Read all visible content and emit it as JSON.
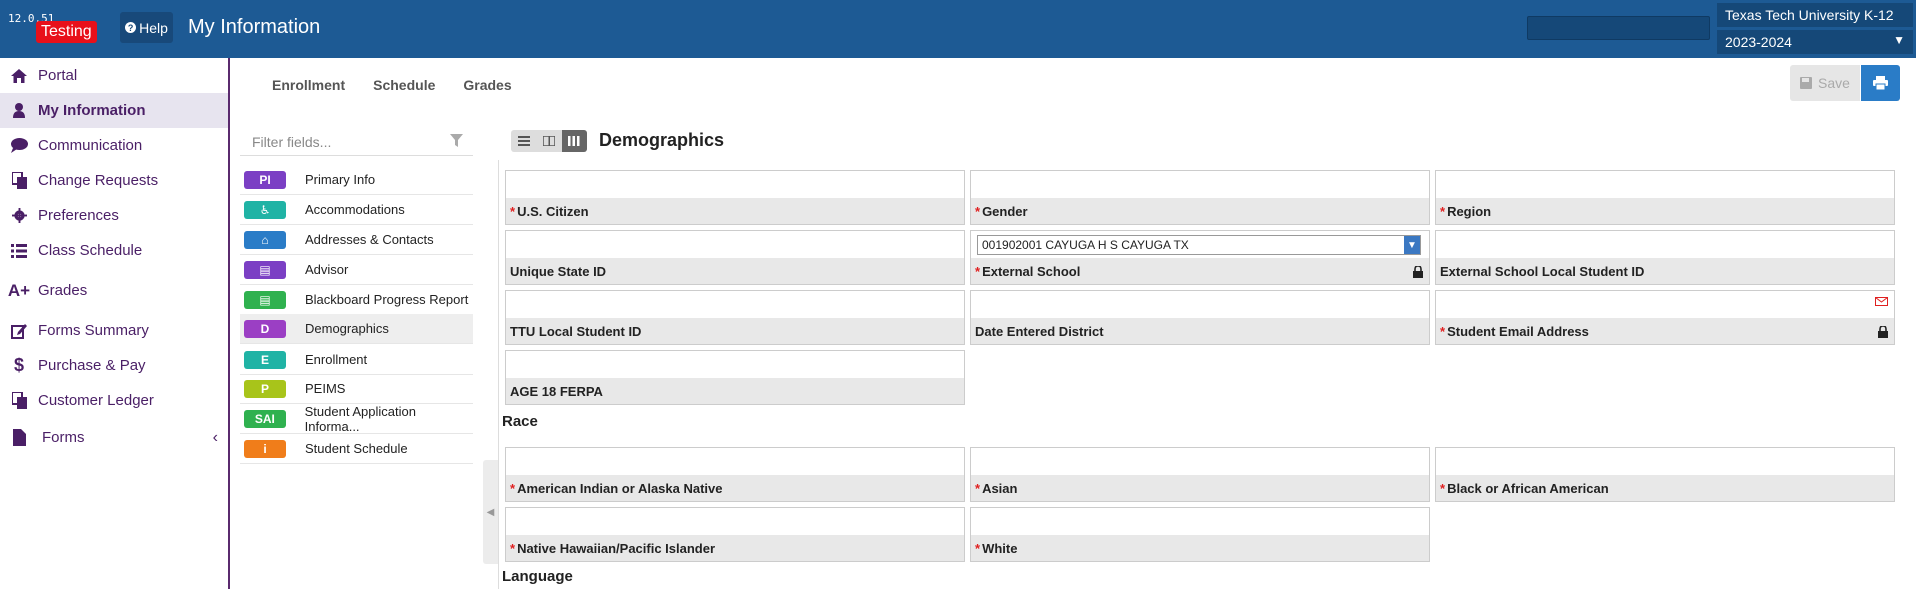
{
  "header": {
    "version": "12.0.51",
    "testing_label": "Testing",
    "help_label": "Help",
    "page_title": "My Information",
    "org": "Texas Tech University K-12",
    "year": "2023-2024",
    "colors": {
      "bar": "#1d5a94",
      "accent": "#4a1f66",
      "testing": "#e8101a"
    }
  },
  "sidebar": {
    "items": [
      {
        "label": "Portal",
        "icon": "home-icon"
      },
      {
        "label": "My Information",
        "icon": "user-icon",
        "active": true
      },
      {
        "label": "Communication",
        "icon": "chat-icon"
      },
      {
        "label": "Change Requests",
        "icon": "copy-icon"
      },
      {
        "label": "Preferences",
        "icon": "gear-icon"
      },
      {
        "label": "Class Schedule",
        "icon": "list-icon"
      },
      {
        "label": "Grades",
        "icon": "a-plus-icon"
      },
      {
        "label": "Forms Summary",
        "icon": "edit-icon"
      },
      {
        "label": "Purchase & Pay",
        "icon": "dollar-icon"
      },
      {
        "label": "Customer Ledger",
        "icon": "copy-icon"
      },
      {
        "label": "Forms",
        "icon": "file-icon"
      }
    ]
  },
  "tabs": [
    "Enrollment",
    "Schedule",
    "Grades"
  ],
  "toolbar": {
    "save_label": "Save"
  },
  "sections": {
    "filter_placeholder": "Filter fields...",
    "items": [
      {
        "badge": "PI",
        "color": "#7b3fc4",
        "label": "Primary Info"
      },
      {
        "badge": "♿",
        "color": "#20b3a5",
        "label": "Accommodations"
      },
      {
        "badge": "⌂",
        "color": "#2a7cc7",
        "label": "Addresses & Contacts"
      },
      {
        "badge": "▤",
        "color": "#7b3fc4",
        "label": "Advisor"
      },
      {
        "badge": "▤",
        "color": "#2fb14f",
        "label": "Blackboard Progress Report"
      },
      {
        "badge": "D",
        "color": "#9b3fc4",
        "label": "Demographics",
        "active": true
      },
      {
        "badge": "E",
        "color": "#20b3a5",
        "label": "Enrollment"
      },
      {
        "badge": "P",
        "color": "#a8c41a",
        "label": "PEIMS"
      },
      {
        "badge": "SAI",
        "color": "#2fb14f",
        "label": "Student Application Informa..."
      },
      {
        "badge": "i",
        "color": "#f07d1a",
        "label": "Student Schedule"
      }
    ]
  },
  "form": {
    "title": "Demographics",
    "fields": {
      "us_citizen": {
        "label": "U.S. Citizen"
      },
      "gender": {
        "label": "Gender"
      },
      "region": {
        "label": "Region"
      },
      "unique_state_id": {
        "label": "Unique State ID"
      },
      "external_school": {
        "label": "External School",
        "value": "001902001 CAYUGA H S CAYUGA TX"
      },
      "external_local_id": {
        "label": "External School Local Student ID"
      },
      "ttu_local_id": {
        "label": "TTU Local Student ID"
      },
      "date_entered": {
        "label": "Date Entered District"
      },
      "student_email": {
        "label": "Student Email Address"
      },
      "age18": {
        "label": "AGE 18 FERPA"
      }
    },
    "race_title": "Race",
    "race": {
      "american_indian": "American Indian or Alaska Native",
      "asian": "Asian",
      "black": "Black or African American",
      "hawaiian": "Native Hawaiian/Pacific Islander",
      "white": "White"
    },
    "language_title": "Language"
  }
}
